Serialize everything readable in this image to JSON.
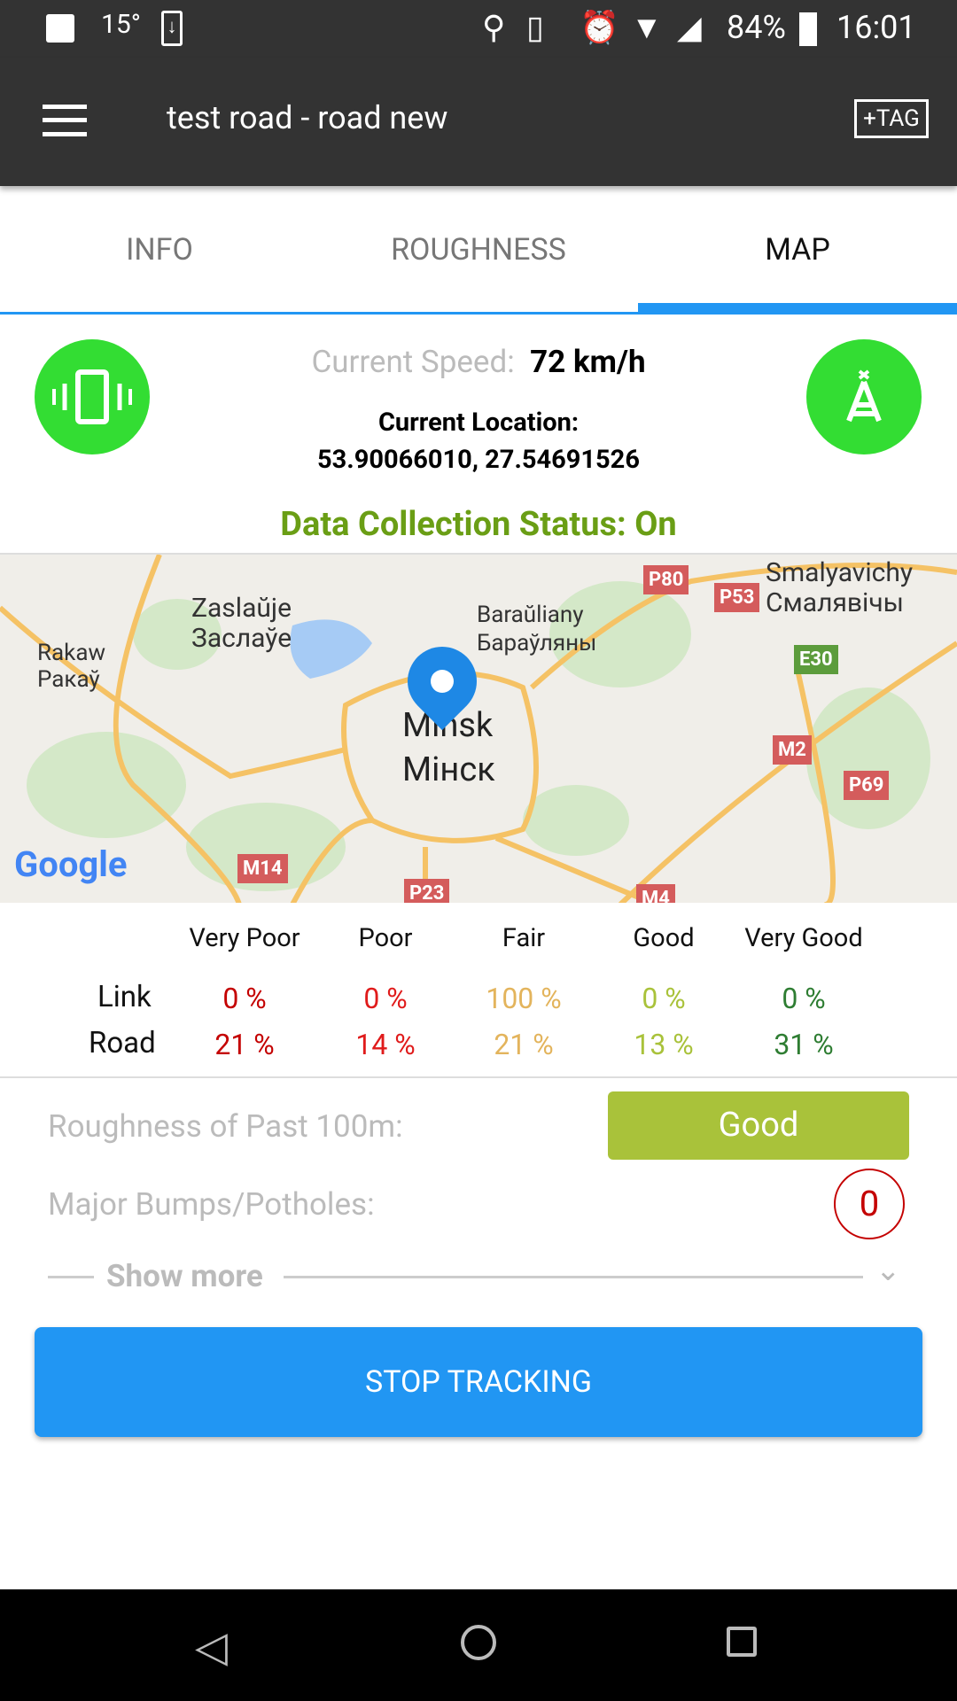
{
  "status_bar": {
    "temperature": "15°",
    "battery": "84%",
    "time": "16:01",
    "icons": [
      "image-icon",
      "download-icon",
      "location-icon",
      "vibrate-icon",
      "alarm-icon",
      "wifi-icon",
      "signal-icon",
      "battery-charging-icon"
    ]
  },
  "toolbar": {
    "title": "test road - road new",
    "tag_label": "+TAG",
    "menu_icon": "hamburger-icon"
  },
  "tabs": [
    {
      "label": "INFO"
    },
    {
      "label": "ROUGHNESS"
    },
    {
      "label": "MAP",
      "active": true
    }
  ],
  "info": {
    "speed_label": "Current Speed:",
    "speed_value": "72 km/h",
    "location_label": "Current Location:",
    "location_value": "53.90066010, 27.54691526",
    "status_text": "Data Collection Status: On"
  },
  "map": {
    "labels": [
      "Zaslaŭje",
      "Заслаўе",
      "Rakaw",
      "Ракаў",
      "Baraŭliany",
      "Бараўляны",
      "Smalyavichy",
      "Смалявічы",
      "Minsk",
      "Мінск"
    ],
    "road_shields": [
      "P80",
      "P53",
      "E30",
      "M2",
      "P69",
      "M14",
      "P23",
      "M4"
    ],
    "logo": "Google"
  },
  "table": {
    "headers": [
      "Very Poor",
      "Poor",
      "Fair",
      "Good",
      "Very Good"
    ],
    "rows": [
      {
        "label": "Link",
        "values": [
          "0 %",
          "0 %",
          "100 %",
          "0 %",
          "0 %"
        ]
      },
      {
        "label": "Road",
        "values": [
          "21 %",
          "14 %",
          "21 %",
          "13 %",
          "31 %"
        ]
      }
    ],
    "colors": [
      "#c40000",
      "#e01b1b",
      "#e3b45c",
      "#a9c23a",
      "#2e7d32"
    ]
  },
  "summary": {
    "roughness_label": "Roughness of Past 100m:",
    "roughness_value": "Good",
    "roughness_color": "#a9c23a",
    "bumps_label": "Major Bumps/Potholes:",
    "bumps_value": "0",
    "show_more": "Show more"
  },
  "action": {
    "stop_label": "STOP TRACKING"
  },
  "accent": "#2196f3"
}
